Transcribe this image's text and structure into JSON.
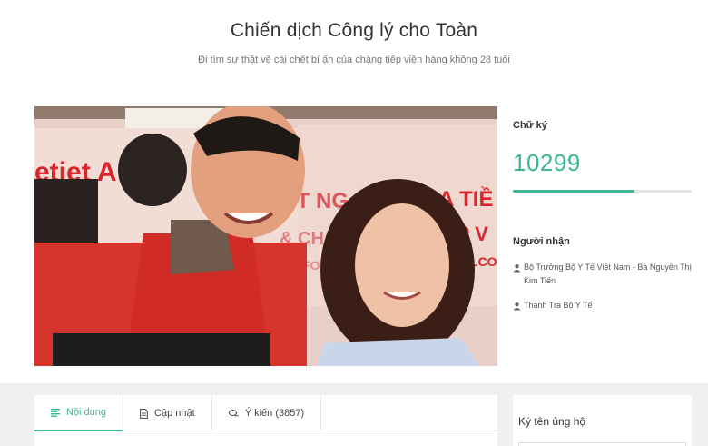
{
  "header": {
    "title": "Chiến dịch Công lý cho Toàn",
    "subtitle": "Đi tìm sự thật về cái chết bí ẩn của chàng tiếp viên hàng không 28 tuổi"
  },
  "photo": {
    "banner_text_left": "etjet A",
    "banner_text_mid": "ỐT NG",
    "banner_text_tie": "A TIỀ",
    "banner_text_2": "& CH",
    "banner_text_3": "ẾP V",
    "banner_text_4": "FOR E",
    "banner_text_5": "LCO"
  },
  "stats": {
    "signature_label": "Chữ ký",
    "signature_count": "10299",
    "progress_fraction": 0.68,
    "accent_color": "#3ab795",
    "recipients_label": "Người nhận",
    "recipients": [
      {
        "icon": "user-icon",
        "name": "Bộ Trưởng Bộ Y Tế Việt Nam - Bà Nguyễn Thị Kim Tiến"
      },
      {
        "icon": "user-icon",
        "name": "Thanh Tra Bộ Y Tế"
      }
    ]
  },
  "tabs": [
    {
      "icon": "text-lines-icon",
      "label": "Nội dung",
      "active": true
    },
    {
      "icon": "document-icon",
      "label": "Cập nhật",
      "active": false
    },
    {
      "icon": "comments-icon",
      "label": "Ý kiến (3857)",
      "active": false
    }
  ],
  "sign_panel": {
    "title": "Ký tên ủng hộ"
  }
}
